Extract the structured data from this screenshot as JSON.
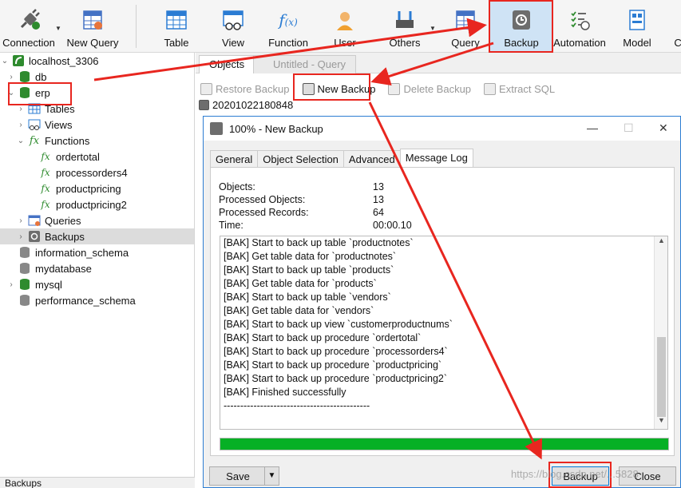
{
  "toolbar": {
    "connection": "Connection",
    "new_query": "New Query",
    "table": "Table",
    "view": "View",
    "function": "Function",
    "user": "User",
    "others": "Others",
    "query": "Query",
    "backup": "Backup",
    "automation": "Automation",
    "model": "Model",
    "truncated": "C"
  },
  "tree": {
    "connection": "localhost_3306",
    "db": "db",
    "erp": "erp",
    "tables": "Tables",
    "views": "Views",
    "functions": "Functions",
    "fn1": "ordertotal",
    "fn2": "processorders4",
    "fn3": "productpricing",
    "fn4": "productpricing2",
    "queries": "Queries",
    "backups": "Backups",
    "information_schema": "information_schema",
    "mydatabase": "mydatabase",
    "mysql": "mysql",
    "performance_schema": "performance_schema"
  },
  "status_left": "Backups",
  "tabs": {
    "objects": "Objects",
    "untitled": "Untitled - Query"
  },
  "objbar": {
    "restore": "Restore Backup",
    "new_backup": "New Backup",
    "delete": "Delete Backup",
    "extract": "Extract SQL"
  },
  "backup_item": "20201022180848",
  "dialog": {
    "title": "100% - New Backup",
    "tabs": {
      "general": "General",
      "object_selection": "Object Selection",
      "advanced": "Advanced",
      "message_log": "Message Log"
    },
    "stats": {
      "objects_label": "Objects:",
      "objects_value": "13",
      "processed_objects_label": "Processed Objects:",
      "processed_objects_value": "13",
      "processed_records_label": "Processed Records:",
      "processed_records_value": "64",
      "time_label": "Time:",
      "time_value": "00:00.10"
    },
    "log": [
      "[BAK] Start to back up table `productnotes`",
      "[BAK] Get table data for `productnotes`",
      "[BAK] Start to back up table `products`",
      "[BAK] Get table data for `products`",
      "[BAK] Start to back up table `vendors`",
      "[BAK] Get table data for `vendors`",
      "[BAK] Start to back up view `customerproductnums`",
      "[BAK] Start to back up procedure `ordertotal`",
      "[BAK] Start to back up procedure `processorders4`",
      "[BAK] Start to back up procedure `productpricing`",
      "[BAK] Start to back up procedure `productpricing2`",
      "[BAK] Finished successfully",
      "--------------------------------------------"
    ],
    "progress": 1.0,
    "save": "Save",
    "backup": "Backup",
    "close": "Close"
  },
  "watermark": "https://blog.csdn.net/...5828",
  "colors": {
    "accent": "#2d7dd2",
    "annotation": "#e8261f",
    "progress": "#06b025"
  }
}
